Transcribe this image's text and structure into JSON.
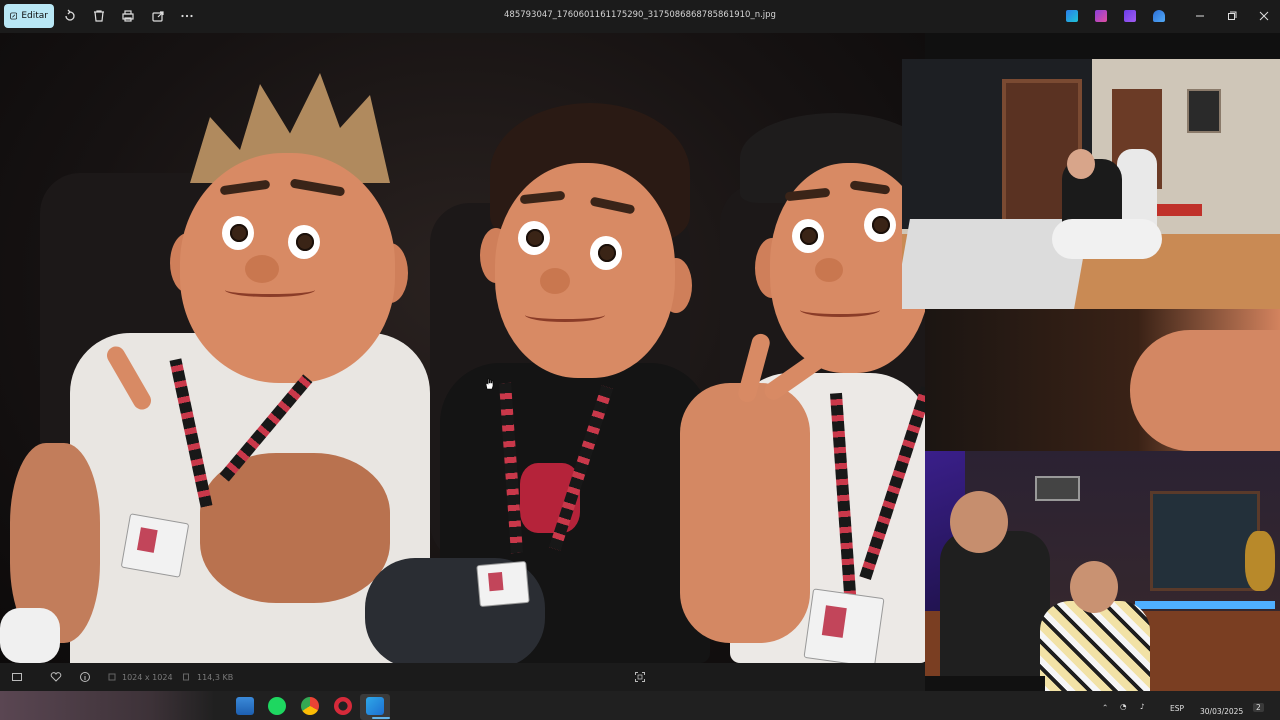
{
  "toolbar": {
    "edit_label": "Editar",
    "filename": "485793047_1760601161175290_3175086868785861910_n.jpg"
  },
  "infobar": {
    "dimensions": "1024 x 1024",
    "filesize": "114,3 KB"
  },
  "taskbar": {
    "language": "ESP",
    "date": "30/03/2025",
    "notifications": "2"
  },
  "colors": {
    "toolbar_bg": "#1b1b1b",
    "edit_accent": "#b9e7f5",
    "taskbar_bg": "#202020"
  }
}
